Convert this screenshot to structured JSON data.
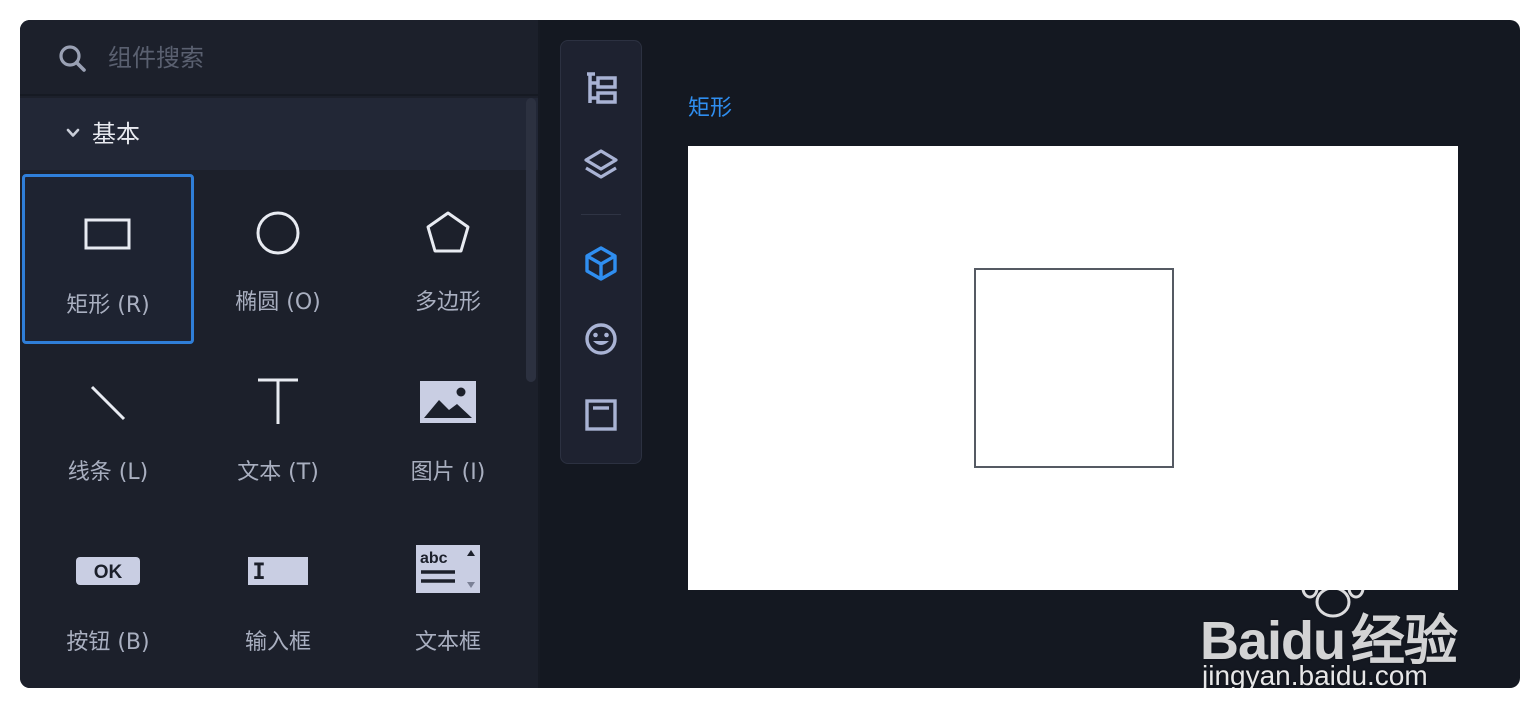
{
  "search": {
    "placeholder": "组件搜索",
    "value": ""
  },
  "section": {
    "title": "基本",
    "icon": "chevron-down-icon"
  },
  "components": [
    {
      "label": "矩形 (R)",
      "icon": "rectangle-icon",
      "selected": true
    },
    {
      "label": "椭圆 (O)",
      "icon": "ellipse-icon",
      "selected": false
    },
    {
      "label": "多边形",
      "icon": "polygon-icon",
      "selected": false
    },
    {
      "label": "线条 (L)",
      "icon": "line-icon",
      "selected": false
    },
    {
      "label": "文本 (T)",
      "icon": "text-icon",
      "selected": false
    },
    {
      "label": "图片 (I)",
      "icon": "image-icon",
      "selected": false
    },
    {
      "label": "按钮 (B)",
      "icon": "button-icon",
      "icon_text": "OK",
      "selected": false
    },
    {
      "label": "输入框",
      "icon": "input-icon",
      "icon_text": "I",
      "selected": false
    },
    {
      "label": "文本框",
      "icon": "textarea-icon",
      "icon_text": "abc",
      "selected": false
    }
  ],
  "toolbar": [
    {
      "icon": "tree-icon",
      "active": false
    },
    {
      "icon": "layers-icon",
      "active": false
    },
    {
      "icon": "cube-icon",
      "active": true
    },
    {
      "icon": "emoji-icon",
      "active": false
    },
    {
      "icon": "panel-icon",
      "active": false
    }
  ],
  "canvas": {
    "label": "矩形",
    "shape": "rectangle"
  },
  "watermark": {
    "brand": "Bai",
    "brand_suffix": "du",
    "brand_cn": "经验",
    "url": "jingyan.baidu.com"
  },
  "colors": {
    "accent": "#2f8ef0",
    "selected_border": "#2f7ed8",
    "panel_bg": "#1c202b",
    "app_bg": "#141821",
    "icon_inactive": "#a9b3d4"
  }
}
